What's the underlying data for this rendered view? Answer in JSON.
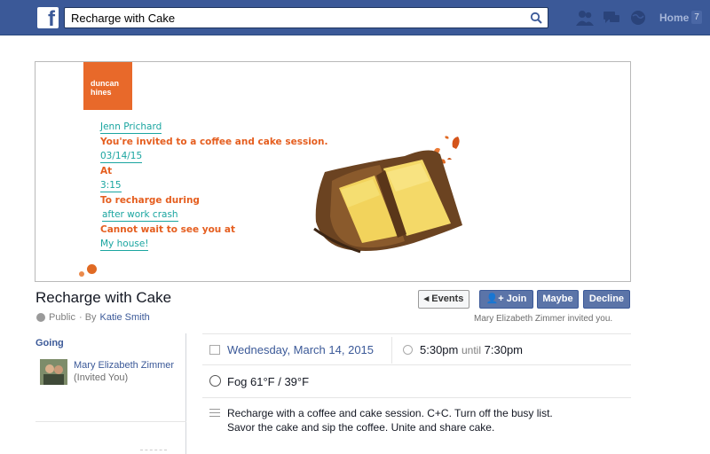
{
  "topbar": {
    "logo": "f",
    "search_value": "Recharge with Cake",
    "home_label": "Home",
    "home_count": "7"
  },
  "banner": {
    "brand_logo_line1": "duncan",
    "brand_logo_line2": "hines",
    "lines": [
      {
        "text": "Jenn Prichard",
        "style": "teal"
      },
      {
        "text": "You're invited to a coffee and cake session.",
        "style": "orange"
      },
      {
        "text": "03/14/15",
        "style": "teal"
      },
      {
        "text": "At",
        "style": "orange"
      },
      {
        "text": "3:15",
        "style": "teal"
      },
      {
        "text": "To recharge during",
        "style": "orange"
      },
      {
        "text": "after work crash",
        "style": "teal"
      },
      {
        "text": "Cannot wait to see you at",
        "style": "orange"
      },
      {
        "text": "My house!",
        "style": "teal"
      }
    ]
  },
  "event": {
    "title": "Recharge with Cake",
    "privacy": "Public",
    "by_label": "· By",
    "host": "Katie Smith",
    "invited_note": "Mary Elizabeth Zimmer invited you."
  },
  "actions": {
    "events": "Events",
    "join": "Join",
    "maybe": "Maybe",
    "decline": "Decline"
  },
  "going": {
    "label": "Going",
    "person_name": "Mary Elizabeth Zimmer",
    "person_sub": "(Invited You)"
  },
  "details": {
    "date": "Wednesday, March 14, 2015",
    "start_time": "5:30pm",
    "until_label": "until",
    "end_time": "7:30pm",
    "weather": "Fog 61°F / 39°F",
    "description": "Recharge with a coffee and cake session. C+C. Turn off the busy list. Savor the cake and sip the coffee. Unite and share cake."
  },
  "colors": {
    "topbar": "#3b5998",
    "brand_orange": "#e8692a",
    "invite_teal": "#1aa5a0",
    "invite_orange": "#e55e1f",
    "link_blue": "#3b5998"
  }
}
